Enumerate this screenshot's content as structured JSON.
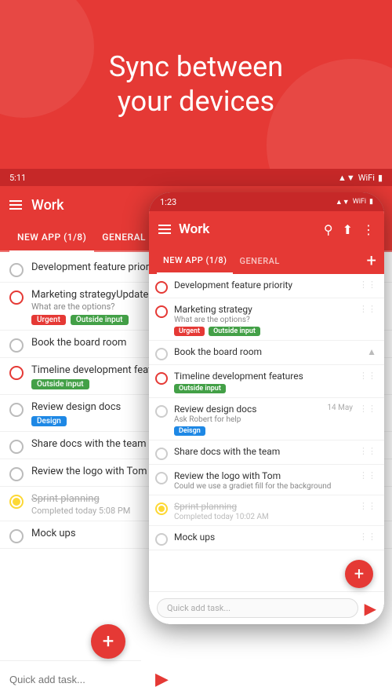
{
  "hero": {
    "line1": "Sync between",
    "line2": "your devices"
  },
  "status_bar_tablet": {
    "time": "5:11",
    "signal": "▲▼",
    "wifi": "WiFi",
    "battery": "🔋"
  },
  "status_bar_phone": {
    "time": "1:23",
    "icons": "▲▼ WiFi 🔋"
  },
  "top_bar": {
    "menu_icon": "☰",
    "title": "Work",
    "search_icon": "🔍",
    "share_icon": "⬆",
    "more_icon": "⋮"
  },
  "tabs": {
    "new_app": "NEW APP (1/8)",
    "general": "GENERAL",
    "add_icon": "+"
  },
  "tasks": [
    {
      "id": "task1",
      "title": "Development feature priority",
      "subtitle": "",
      "tags": [],
      "checked": false,
      "date": "",
      "strikethrough": false
    },
    {
      "id": "task2",
      "title": "Marketing strategy",
      "subtitle": "What are the options?",
      "tags": [
        "Urgent",
        "Outside input"
      ],
      "checked": false,
      "date": "",
      "strikethrough": false
    },
    {
      "id": "task3",
      "title": "Book the board room",
      "subtitle": "",
      "tags": [],
      "checked": false,
      "date": "",
      "strikethrough": false
    },
    {
      "id": "task4",
      "title": "Timeline development features",
      "subtitle": "",
      "tags": [
        "Outside input"
      ],
      "checked": false,
      "date": "",
      "strikethrough": false
    },
    {
      "id": "task5",
      "title": "Review design docs",
      "subtitle": "Ask Robert for help",
      "tags": [
        "Deisgn"
      ],
      "checked": false,
      "date": "14 May",
      "strikethrough": false
    },
    {
      "id": "task6",
      "title": "Share docs with the team",
      "subtitle": "",
      "tags": [],
      "checked": false,
      "date": "",
      "strikethrough": false
    },
    {
      "id": "task7",
      "title": "Review the logo with Tom",
      "subtitle": "Could we use a gradiet fill for the background",
      "tags": [],
      "checked": false,
      "date": "",
      "strikethrough": false
    },
    {
      "id": "task8",
      "title": "Sprint planning",
      "subtitle": "Completed today 10:02 AM",
      "tags": [],
      "checked": "yellow",
      "date": "",
      "strikethrough": true
    },
    {
      "id": "task9",
      "title": "Mock ups",
      "subtitle": "",
      "tags": [],
      "checked": false,
      "date": "",
      "strikethrough": false
    }
  ],
  "tasks_tablet": [
    {
      "id": "t1",
      "title": "Development feature priority",
      "subtitle": "",
      "tags": [],
      "checked": false,
      "date": "",
      "strikethrough": false
    },
    {
      "id": "t2",
      "title": "Marketing strategyUpdate CV",
      "subtitle": "What are the options?",
      "tags": [
        "Urgent",
        "Outside input"
      ],
      "checked": false,
      "date": "",
      "strikethrough": false
    },
    {
      "id": "t3",
      "title": "Book the board room",
      "subtitle": "",
      "tags": [],
      "checked": false,
      "date": "",
      "strikethrough": false
    },
    {
      "id": "t4",
      "title": "Timeline development features",
      "subtitle": "",
      "tags": [
        "Outside input"
      ],
      "checked": false,
      "date": "",
      "strikethrough": false
    },
    {
      "id": "t5",
      "title": "Review design docs",
      "subtitle": "",
      "tags": [
        "Design"
      ],
      "checked": false,
      "date": "",
      "strikethrough": false
    },
    {
      "id": "t6",
      "title": "Share docs with the team",
      "subtitle": "",
      "tags": [],
      "checked": false,
      "date": "",
      "strikethrough": false
    },
    {
      "id": "t7",
      "title": "Review the logo with Tom",
      "subtitle": "",
      "tags": [],
      "checked": false,
      "date": "",
      "strikethrough": false
    },
    {
      "id": "t8",
      "title": "Sprint planning",
      "subtitle": "Completed today 5:08 PM",
      "tags": [],
      "checked": "yellow",
      "date": "",
      "strikethrough": true
    },
    {
      "id": "t9",
      "title": "Mock ups",
      "subtitle": "",
      "tags": [],
      "checked": false,
      "date": "",
      "strikethrough": false
    }
  ],
  "quick_add": {
    "placeholder": "Quick add task...",
    "send_icon": "▶"
  },
  "colors": {
    "primary": "#e53935",
    "dark_primary": "#c62828",
    "urgent": "#e53935",
    "outside_input": "#43a047",
    "design": "#1e88e5",
    "yellow": "#fdd835"
  }
}
